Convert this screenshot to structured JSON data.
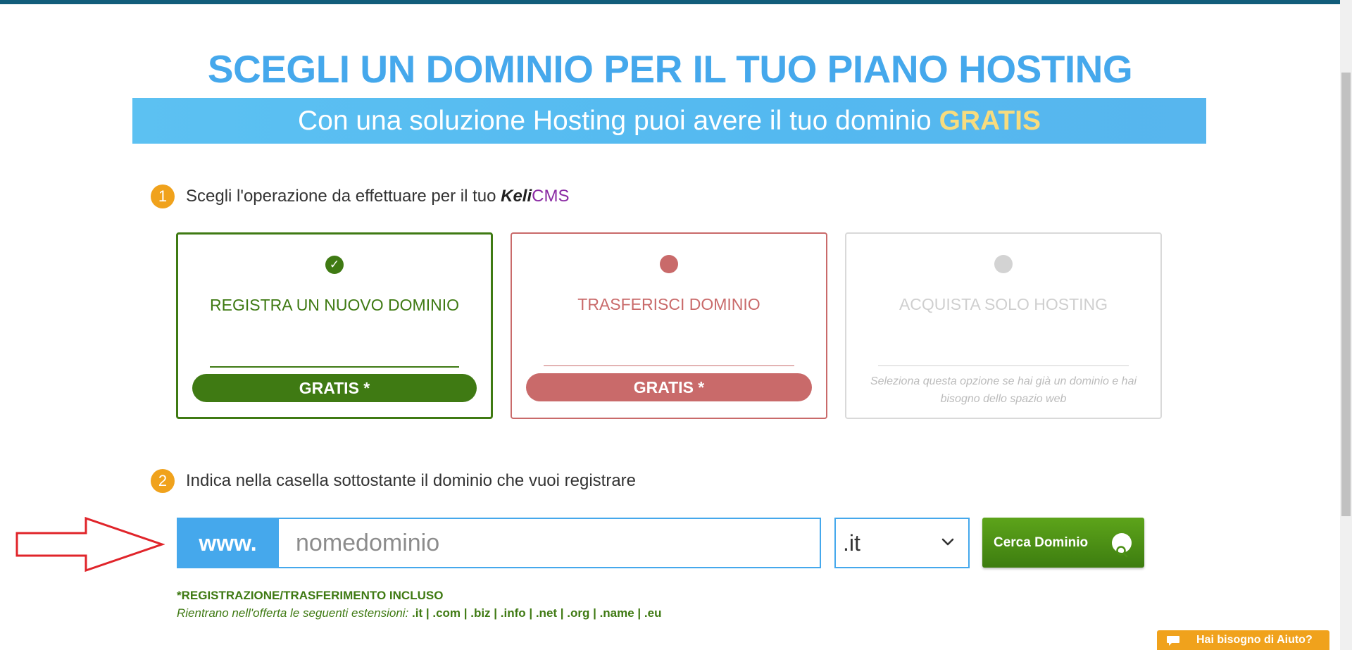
{
  "page": {
    "title": "SCEGLI UN DOMINIO PER IL TUO PIANO HOSTING",
    "banner_text": "Con una soluzione Hosting puoi avere il tuo dominio",
    "banner_highlight": "GRATIS"
  },
  "step1": {
    "number": "1",
    "text": "Scegli l'operazione da effettuare per il tuo",
    "brand_keli": "Keli",
    "brand_cms": "CMS"
  },
  "options": [
    {
      "title": "REGISTRA UN NUOVO DOMINIO",
      "badge": "GRATIS *",
      "state": "selected",
      "icon": "check-icon"
    },
    {
      "title": "TRASFERISCI DOMINIO",
      "badge": "GRATIS *",
      "state": "unselected",
      "icon": "radio-dot-icon"
    },
    {
      "title": "ACQUISTA SOLO HOSTING",
      "note": "Seleziona questa opzione se hai già un dominio e hai bisogno dello spazio web",
      "state": "disabled",
      "icon": "radio-dot-icon"
    }
  ],
  "step2": {
    "number": "2",
    "text": "Indica nella casella sottostante il dominio che vuoi registrare"
  },
  "search": {
    "prefix": "www.",
    "placeholder": "nomedominio",
    "tld_selected": ".it",
    "button_label": "Cerca Dominio"
  },
  "footer": {
    "included": "*REGISTRAZIONE/TRASFERIMENTO INCLUSO",
    "extensions_lead": "Rientrano nell'offerta le seguenti estensioni:",
    "extensions_list": ".it | .com | .biz | .info | .net | .org | .name | .eu"
  },
  "help": {
    "label": "Hai bisogno di Aiuto?"
  },
  "colors": {
    "accent_blue": "#45a8ec",
    "green": "#3f7a13",
    "red": "#c96a6a",
    "orange": "#f0a21c",
    "annotation_arrow": "#e0242a"
  }
}
